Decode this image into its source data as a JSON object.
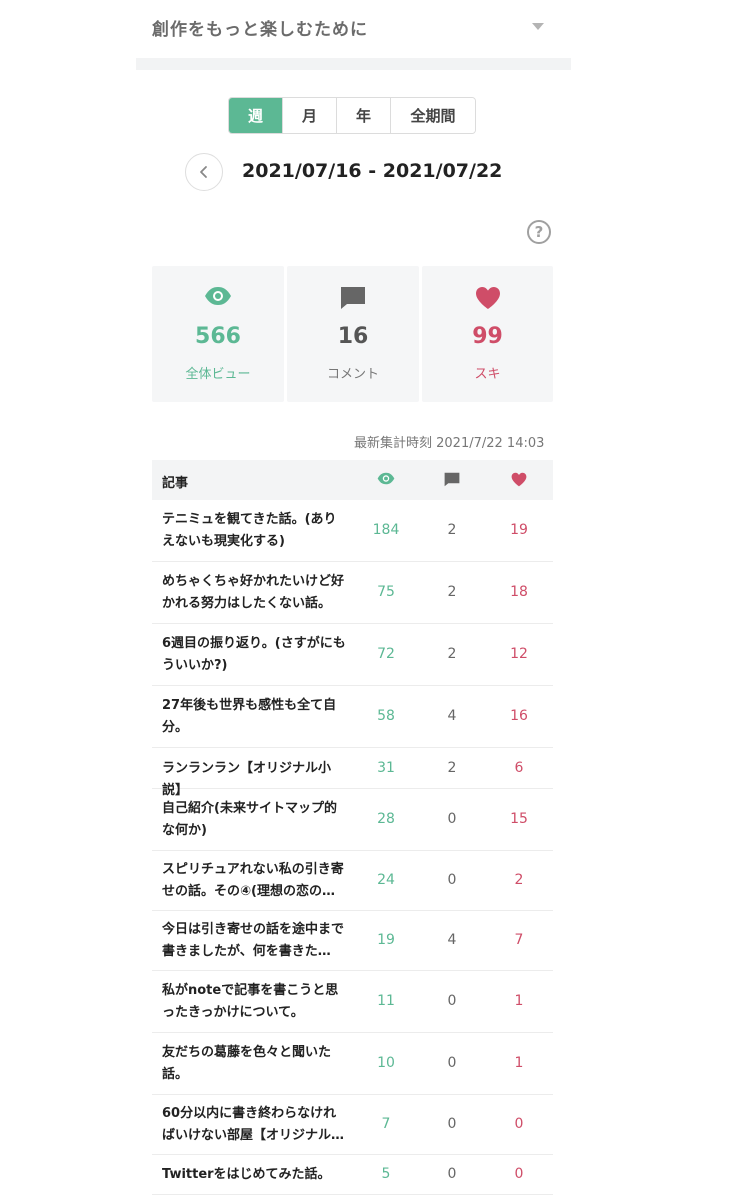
{
  "header": {
    "title": "創作をもっと楽しむために"
  },
  "period_tabs": [
    {
      "label": "週",
      "active": true,
      "width": 54
    },
    {
      "label": "月",
      "active": false,
      "width": 54
    },
    {
      "label": "年",
      "active": false,
      "width": 54
    },
    {
      "label": "全期間",
      "active": false,
      "width": 84
    }
  ],
  "date_range": "2021/07/16 - 2021/07/22",
  "stats": {
    "views": {
      "value": "566",
      "label": "全体ビュー"
    },
    "comments": {
      "value": "16",
      "label": "コメント"
    },
    "likes": {
      "value": "99",
      "label": "スキ"
    }
  },
  "updated_at": "最新集計時刻 2021/7/22 14:03",
  "table": {
    "col_title": "記事",
    "rows": [
      {
        "title": "テニミュを観てきた話。(ありえないも現実化する)",
        "views": "184",
        "comments": "2",
        "likes": "19"
      },
      {
        "title": "めちゃくちゃ好かれたいけど好かれる努力はしたくない話。",
        "views": "75",
        "comments": "2",
        "likes": "18"
      },
      {
        "title": "6週目の振り返り。(さすがにもういいか?)",
        "views": "72",
        "comments": "2",
        "likes": "12"
      },
      {
        "title": "27年後も世界も感性も全て自分。",
        "views": "58",
        "comments": "4",
        "likes": "16"
      },
      {
        "title": "ランランラン【オリジナル小説】",
        "views": "31",
        "comments": "2",
        "likes": "6"
      },
      {
        "title": "自己紹介(未来サイトマップ的な何か)",
        "views": "28",
        "comments": "0",
        "likes": "15"
      },
      {
        "title": "スピリチュアれない私の引き寄せの話。その④(理想の恋の…",
        "views": "24",
        "comments": "0",
        "likes": "2"
      },
      {
        "title": "今日は引き寄せの話を途中まで書きましたが、何を書きた…",
        "views": "19",
        "comments": "4",
        "likes": "7"
      },
      {
        "title": "私がnoteで記事を書こうと思ったきっかけについて。",
        "views": "11",
        "comments": "0",
        "likes": "1"
      },
      {
        "title": "友だちの葛藤を色々と聞いた話。",
        "views": "10",
        "comments": "0",
        "likes": "1"
      },
      {
        "title": "60分以内に書き終わらなければいけない部屋【オリジナル…",
        "views": "7",
        "comments": "0",
        "likes": "0"
      },
      {
        "title": "Twitterをはじめてみた話。",
        "views": "5",
        "comments": "0",
        "likes": "0"
      }
    ]
  },
  "colors": {
    "accent": "#5cb894",
    "like": "#cf4d68",
    "comment": "#666666"
  }
}
